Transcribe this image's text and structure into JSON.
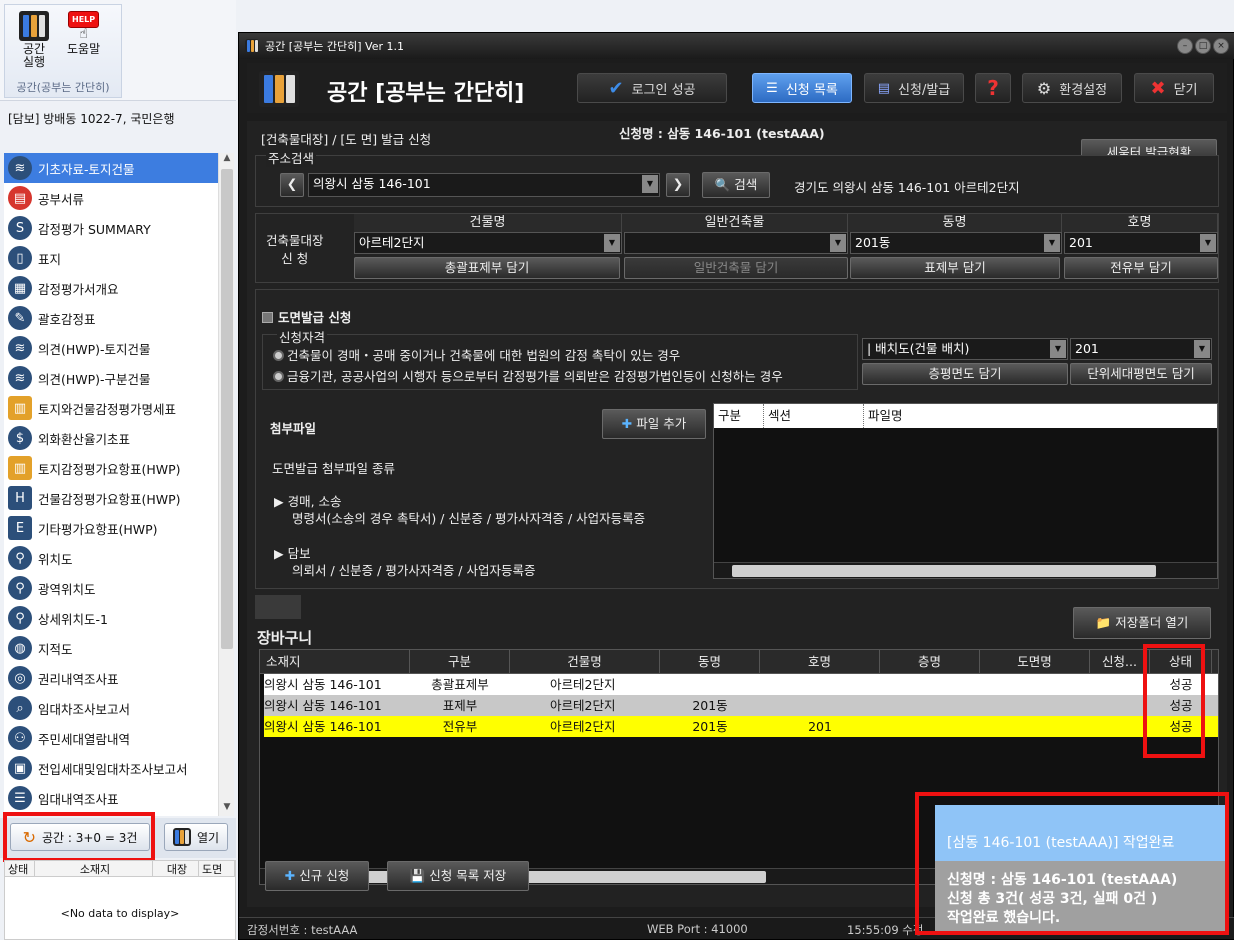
{
  "ribbon": {
    "buttons": [
      {
        "label": "공간\n실행"
      },
      {
        "label": "도움말"
      }
    ],
    "help_badge": "HELP",
    "group_label": "공간(공부는 간단히)"
  },
  "left": {
    "address": "[담보] 방배동 1022-7, 국민은행",
    "nav_items": [
      {
        "label": "기초자료-토지건물",
        "icon": "database-icon"
      },
      {
        "label": "공부서류",
        "icon": "document-icon"
      },
      {
        "label": "감정평가 SUMMARY",
        "icon": "summary-icon"
      },
      {
        "label": "표지",
        "icon": "cover-icon"
      },
      {
        "label": "감정평가서개요",
        "icon": "clipboard-icon"
      },
      {
        "label": "괄호감정표",
        "icon": "stamp-icon"
      },
      {
        "label": "의견(HWP)-토지건물",
        "icon": "database-icon"
      },
      {
        "label": "의견(HWP)-구분건물",
        "icon": "database-icon"
      },
      {
        "label": "토지와건물감정평가명세표",
        "icon": "book-icon"
      },
      {
        "label": "외화환산율기초표",
        "icon": "dollar-icon"
      },
      {
        "label": "토지감정평가요항표(HWP)",
        "icon": "book-icon"
      },
      {
        "label": "건물감정평가요항표(HWP)",
        "icon": "hwp-icon"
      },
      {
        "label": "기타평가요항표(HWP)",
        "icon": "etc-hwp-icon"
      },
      {
        "label": "위치도",
        "icon": "pin-icon"
      },
      {
        "label": "광역위치도",
        "icon": "pin-icon"
      },
      {
        "label": "상세위치도-1",
        "icon": "pin-icon"
      },
      {
        "label": "지적도",
        "icon": "globe-icon"
      },
      {
        "label": "권리내역조사표",
        "icon": "fingerprint-icon"
      },
      {
        "label": "임대차조사보고서",
        "icon": "search-doc-icon"
      },
      {
        "label": "주민세대열람내역",
        "icon": "people-icon"
      },
      {
        "label": "전입세대및임대차조사보고서",
        "icon": "id-card-icon"
      },
      {
        "label": "임대내역조사표",
        "icon": "list-icon"
      }
    ],
    "count_button": "공간 : 3+0 = 3건",
    "open_button": "열기",
    "grid_headers": [
      "상태",
      "소재지",
      "대장",
      "도면"
    ],
    "no_data": "<No data to display>"
  },
  "window": {
    "title": "공간 [공부는 간단히] Ver 1.1",
    "app_title": "공간 [공부는 간단히]",
    "toolbar": {
      "login": "로그인 성공",
      "list": "신청 목록",
      "apply": "신청/발급",
      "help": "?",
      "settings": "환경설정",
      "close": "닫기"
    },
    "section_label": "[건축물대장] / [도 면] 발급 신청",
    "request_name": "신청명 : 삼동 146-101 (testAAA)",
    "seumter_button": "세움터 발급현황",
    "address_search": {
      "label": "주소검색",
      "value": "의왕시 삼동 146-101",
      "search": "검색",
      "result": "경기도 의왕시 삼동 146-101 아르테2단지"
    },
    "ledger": {
      "side_label": "건축물대장\n신 청",
      "columns": [
        "건물명",
        "일반건축물",
        "동명",
        "호명"
      ],
      "values": [
        "아르테2단지",
        "",
        "201동",
        "201"
      ],
      "buttons": [
        "총괄표제부 담기",
        "일반건축물 담기",
        "표제부 담기",
        "전유부 담기"
      ]
    },
    "drawing": {
      "title": "도면발급 신청",
      "qual_label": "신청자격",
      "options": [
        "건축물이 경매・공매 중이거나 건축물에 대한 법원의 감정 촉탁이 있는 경우",
        "금융기관, 공공사업의 시행자 등으로부터 감정평가를 의뢰받은 감정평가법인등이 신청하는 경우"
      ],
      "type_value": "| 배치도(건물 배치)",
      "unit_value": "201",
      "floor_button": "층평면도 담기",
      "unit_button": "단위세대평면도 담기"
    },
    "attach": {
      "label": "첨부파일",
      "add_button": "파일 추가",
      "kinds_title": "도면발급 첨부파일 종류",
      "group1_title": "경매, 소송",
      "group1_body": "명령서(소송의 경우 촉탁서) / 신분증 / 평가사자격증 / 사업자등록증",
      "group2_title": "담보",
      "group2_body": "의뢰서 / 신분증 / 평가사자격증 / 사업자등록증",
      "grid_headers": [
        "구분",
        "섹션",
        "파일명"
      ]
    },
    "cart": {
      "label": "장바구니",
      "save_folder": "저장폴더 열기",
      "headers": [
        "소재지",
        "구분",
        "건물명",
        "동명",
        "호명",
        "층명",
        "도면명",
        "신청...",
        "상태"
      ],
      "rows": [
        [
          "의왕시 삼동 146-101",
          "총괄표제부",
          "아르테2단지",
          "",
          "",
          "",
          "",
          "",
          "성공"
        ],
        [
          "의왕시 삼동 146-101",
          "표제부",
          "아르테2단지",
          "201동",
          "",
          "",
          "",
          "",
          "성공"
        ],
        [
          "의왕시 삼동 146-101",
          "전유부",
          "아르테2단지",
          "201동",
          "201",
          "",
          "",
          "",
          "성공"
        ]
      ]
    },
    "bottom": {
      "new": "신규 신청",
      "save_list": "신청 목록 저장"
    },
    "status": {
      "appraiser": "감정서번호 : testAAA",
      "port": "WEB Port : 41000",
      "time": "15:55:09 수정"
    }
  },
  "toast": {
    "header": "[삼동 146-101 (testAAA)] 작업완료",
    "line1": "신청명 : 삼동 146-101 (testAAA)",
    "line2": "신청 총 3건( 성공  3건, 실패 0건 )",
    "line3": "작업완료 했습니다."
  },
  "colors": {
    "accent": "#3d7de0",
    "highlight": "#ffff00",
    "alert": "#ee1111",
    "toast": "#8fc4f7"
  }
}
